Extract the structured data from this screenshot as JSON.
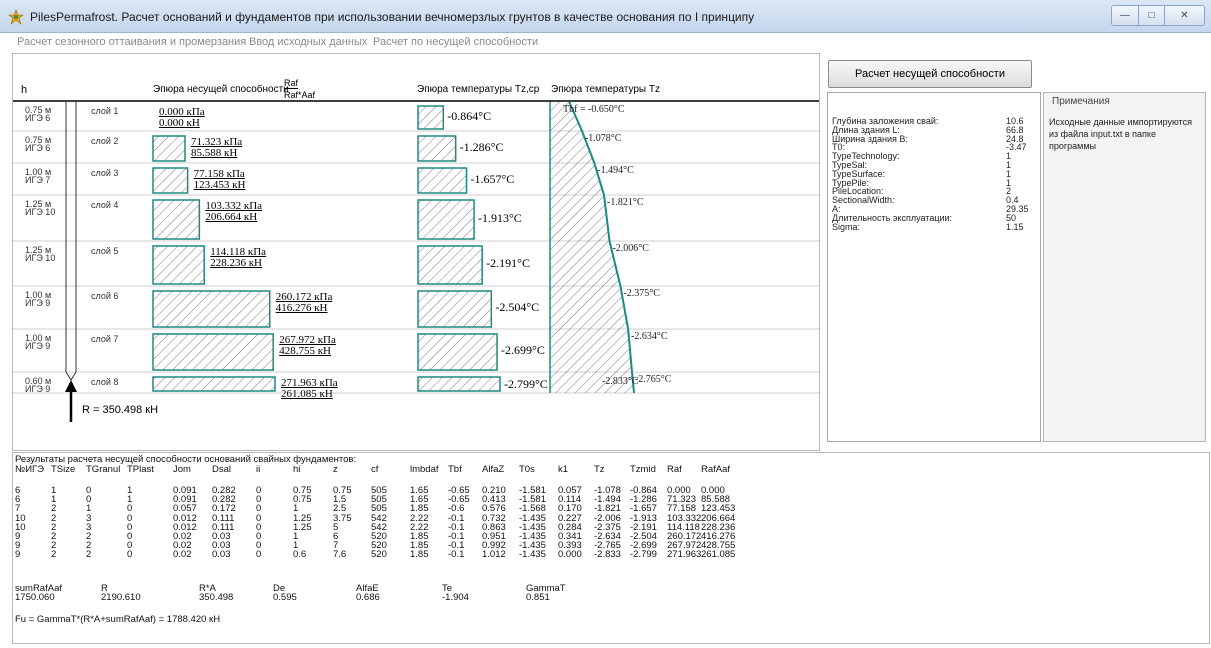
{
  "window": {
    "title": "PilesPermafrost. Расчет оснований и фундаментов при использовании вечномерзлых грунтов в качестве основания по I принципу"
  },
  "menu": [
    "Расчет сезонного оттаивания и промерзания",
    "Ввод исходных данных",
    "Расчет по несущей способности"
  ],
  "chart": {
    "h_label": "h",
    "capacity_title": "Эпюра несущей способности",
    "frac_num": "Raf",
    "frac_den": "Raf*Aaf",
    "temp_avg_title": "Эпюра температуры Tz,cp",
    "temp_title": "Эпюра температуры Tz",
    "tbf_label": "Tbf = -0.650°C",
    "bottom_temp": "-2.833°C",
    "resultant": "R = 350.498 кН",
    "layers": [
      {
        "depth": "0.75 м",
        "ige": "ИГЭ 6",
        "name": "слой 1",
        "raf": "0.000 кПа",
        "rafaaf": "0.000 кН",
        "tzmid": "-0.864°C",
        "tz": "",
        "v_raf": 0.0,
        "v_tzmid": -0.864,
        "v_tz": -1.078
      },
      {
        "depth": "0.75 м",
        "ige": "ИГЭ 6",
        "name": "слой 2",
        "raf": "71.323 кПа",
        "rafaaf": "85.588 кН",
        "tzmid": "-1.286°C",
        "tz": "-1.078°C",
        "v_raf": 71.323,
        "v_tzmid": -1.286,
        "v_tz": -1.494
      },
      {
        "depth": "1.00 м",
        "ige": "ИГЭ 7",
        "name": "слой 3",
        "raf": "77.158 кПа",
        "rafaaf": "123.453 кН",
        "tzmid": "-1.657°C",
        "tz": "-1.494°C",
        "v_raf": 77.158,
        "v_tzmid": -1.657,
        "v_tz": -1.821
      },
      {
        "depth": "1.25 м",
        "ige": "ИГЭ 10",
        "name": "слой 4",
        "raf": "103.332 кПа",
        "rafaaf": "206.664 кН",
        "tzmid": "-1.913°C",
        "tz": "-1.821°C",
        "v_raf": 103.332,
        "v_tzmid": -1.913,
        "v_tz": -2.006
      },
      {
        "depth": "1.25 м",
        "ige": "ИГЭ 10",
        "name": "слой 5",
        "raf": "114.118 кПа",
        "rafaaf": "228.236 кН",
        "tzmid": "-2.191°C",
        "tz": "-2.006°C",
        "v_raf": 114.118,
        "v_tzmid": -2.191,
        "v_tz": -2.375
      },
      {
        "depth": "1.00 м",
        "ige": "ИГЭ 9",
        "name": "слой 6",
        "raf": "260.172 кПа",
        "rafaaf": "416.276 кН",
        "tzmid": "-2.504°C",
        "tz": "-2.375°C",
        "v_raf": 260.172,
        "v_tzmid": -2.504,
        "v_tz": -2.634
      },
      {
        "depth": "1.00 м",
        "ige": "ИГЭ 9",
        "name": "слой 7",
        "raf": "267.972 кПа",
        "rafaaf": "428.755 кН",
        "tzmid": "-2.699°C",
        "tz": "-2.634°C",
        "v_raf": 267.972,
        "v_tzmid": -2.699,
        "v_tz": -2.765
      },
      {
        "depth": "0.60 м",
        "ige": "ИГЭ 9",
        "name": "слой 8",
        "raf": "271.963 кПа",
        "rafaaf": "261.085 кН",
        "tzmid": "-2.799°C",
        "tz": "-2.765°C",
        "v_raf": 271.963,
        "v_tzmid": -2.799,
        "v_tz": -2.833
      }
    ],
    "colors": {
      "fill_edge": "#1d8a80",
      "hatch": "#444444",
      "divider": "#cfcfcf"
    }
  },
  "action_button": "Расчет несущей способности",
  "params": [
    {
      "k": "Глубина заложения свай:",
      "v": "10.6"
    },
    {
      "k": "Длина здания L:",
      "v": "66.8"
    },
    {
      "k": "Ширина здания B:",
      "v": "24.8"
    },
    {
      "k": "T0:",
      "v": "-3.47"
    },
    {
      "k": "TypeTechnology:",
      "v": "1"
    },
    {
      "k": "TypeSal:",
      "v": "1"
    },
    {
      "k": "TypeSurface:",
      "v": "1"
    },
    {
      "k": "TypePile:",
      "v": "1"
    },
    {
      "k": "PileLocation:",
      "v": "2"
    },
    {
      "k": "SectionalWidth:",
      "v": "0.4"
    },
    {
      "k": "A:",
      "v": "29.35"
    },
    {
      "k": "Длительность эксплуатации:",
      "v": "50"
    },
    {
      "k": "Sigma:",
      "v": "1.15"
    }
  ],
  "notes": {
    "title": "Примечания",
    "text": "Исходные данные импортируются из файла input.txt в папке программы"
  },
  "results": {
    "heading": "Результаты расчета несущей способности оснований свайных фундаментов:",
    "columns": [
      "№ИГЭ",
      "TSize",
      "TGranul",
      "TPlast",
      "Jom",
      "Dsal",
      "ii",
      "hi",
      "z",
      "cf",
      "lmbdaf",
      "Tbf",
      "AlfaZ",
      "T0s",
      "k1",
      "Tz",
      "Tzmid",
      "Raf",
      "RafAaf"
    ],
    "rows": [
      [
        "6",
        "1",
        "0",
        "1",
        "0.091",
        "0.282",
        "0",
        "0.75",
        "0.75",
        "505",
        "1.65",
        "-0.65",
        "0.210",
        "-1.581",
        "0.057",
        "-1.078",
        "-0.864",
        "0.000",
        "0.000"
      ],
      [
        "6",
        "1",
        "0",
        "1",
        "0.091",
        "0.282",
        "0",
        "0.75",
        "1.5",
        "505",
        "1.65",
        "-0.65",
        "0.413",
        "-1.581",
        "0.114",
        "-1.494",
        "-1.286",
        "71.323",
        "85.588"
      ],
      [
        "7",
        "2",
        "1",
        "0",
        "0.057",
        "0.172",
        "0",
        "1",
        "2.5",
        "505",
        "1.85",
        "-0.6",
        "0.576",
        "-1.568",
        "0.170",
        "-1.821",
        "-1.657",
        "77.158",
        "123.453"
      ],
      [
        "10",
        "2",
        "3",
        "0",
        "0.012",
        "0.111",
        "0",
        "1.25",
        "3.75",
        "542",
        "2.22",
        "-0.1",
        "0.732",
        "-1.435",
        "0.227",
        "-2.006",
        "-1.913",
        "103.332",
        "206.664"
      ],
      [
        "10",
        "2",
        "3",
        "0",
        "0.012",
        "0.111",
        "0",
        "1.25",
        "5",
        "542",
        "2.22",
        "-0.1",
        "0.863",
        "-1.435",
        "0.284",
        "-2.375",
        "-2.191",
        "114.118",
        "228.236"
      ],
      [
        "9",
        "2",
        "2",
        "0",
        "0.02",
        "0.03",
        "0",
        "1",
        "6",
        "520",
        "1.85",
        "-0.1",
        "0.951",
        "-1.435",
        "0.341",
        "-2.634",
        "-2.504",
        "260.172",
        "416.276"
      ],
      [
        "9",
        "2",
        "2",
        "0",
        "0.02",
        "0.03",
        "0",
        "1",
        "7",
        "520",
        "1.85",
        "-0.1",
        "0.992",
        "-1.435",
        "0.393",
        "-2.765",
        "-2.699",
        "267.972",
        "428.755"
      ],
      [
        "9",
        "2",
        "2",
        "0",
        "0.02",
        "0.03",
        "0",
        "0.6",
        "7.6",
        "520",
        "1.85",
        "-0.1",
        "1.012",
        "-1.435",
        "0.000",
        "-2.833",
        "-2.799",
        "271.963",
        "261.085"
      ]
    ],
    "summary": [
      {
        "k": "sumRafAaf",
        "v": "1750.060"
      },
      {
        "k": "R",
        "v": "2190.610"
      },
      {
        "k": "R*A",
        "v": "350.498"
      },
      {
        "k": "De",
        "v": "0.595"
      },
      {
        "k": "AlfaE",
        "v": "0.686"
      },
      {
        "k": "Te",
        "v": "-1.904"
      },
      {
        "k": "GammaT",
        "v": "0.851"
      }
    ],
    "formula": "Fu = GammaT*(R*A+sumRafAaf) = 1788.420 кН"
  }
}
